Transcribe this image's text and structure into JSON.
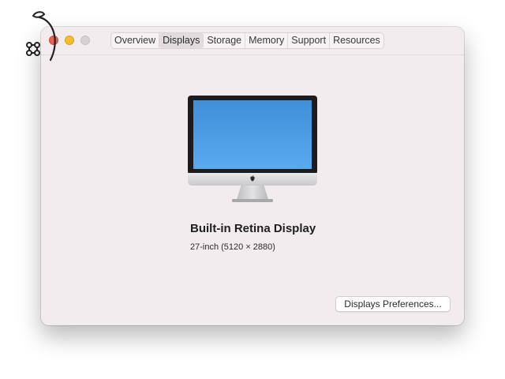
{
  "window": {
    "tabs": [
      {
        "label": "Overview",
        "active": false
      },
      {
        "label": "Displays",
        "active": true
      },
      {
        "label": "Storage",
        "active": false
      },
      {
        "label": "Memory",
        "active": false
      },
      {
        "label": "Support",
        "active": false
      },
      {
        "label": "Resources",
        "active": false
      }
    ]
  },
  "display": {
    "name": "Built-in Retina Display",
    "spec": "27-inch (5120 × 2880)"
  },
  "actions": {
    "preferences_label": "Displays Preferences..."
  },
  "colors": {
    "window_bg": "#f2ecef",
    "close": "#ee5f56",
    "minimize": "#f6bd2f",
    "zoom": "#d6d1d3",
    "screen_blue": "#4a9ee8"
  }
}
